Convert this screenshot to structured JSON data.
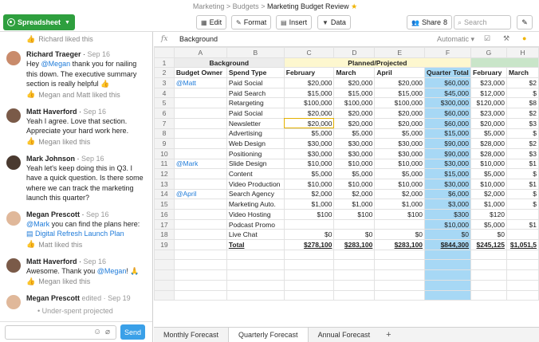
{
  "breadcrumb": {
    "parts": [
      "Marketing",
      ">",
      "Budgets",
      ">"
    ],
    "current": "Marketing Budget Review",
    "star": "★"
  },
  "app_button": "Spreadsheet",
  "toolbar": {
    "edit": "Edit",
    "format": "Format",
    "insert": "Insert",
    "data": "Data",
    "share": "Share",
    "share_count": "8",
    "search_placeholder": "Search"
  },
  "formula_bar": {
    "fx": "fx",
    "value": "Background",
    "format": "Automatic"
  },
  "chat": {
    "top_like": "Richard liked this",
    "messages": [
      {
        "name": "Richard Traeger",
        "time": "Sep 16",
        "pre": "Hey ",
        "mention": "@Megan",
        "post": " thank you for nailing this down. The executive summary section is really helpful 👍",
        "likes": "Megan and Matt liked this"
      },
      {
        "name": "Matt Haverford",
        "time": "Sep 16",
        "pre": "Yeah I agree. Love that section. Appreciate your hard work here.",
        "mention": "",
        "post": "",
        "likes": "Megan liked this"
      },
      {
        "name": "Mark Johnson",
        "time": "Sep 16",
        "pre": "Yeah let's keep doing this in Q3. I have a quick question. Is there some where we can track the marketing launch this quarter?",
        "mention": "",
        "post": "",
        "likes": ""
      },
      {
        "name": "Megan Prescott",
        "time": "Sep 16",
        "pre": "",
        "mention": "@Mark",
        "post": " you can find the plans here:",
        "link": "Digital Refresh Launch Plan",
        "likes": "Matt liked this"
      },
      {
        "name": "Matt Haverford",
        "time": "Sep 16",
        "pre": "Awesome. Thank you ",
        "mention": "@Megan",
        "post": "! 🙏",
        "likes": "Megan liked this"
      },
      {
        "name": "Megan Prescott",
        "time": "edited · Sep 19",
        "pre": "",
        "mention": "",
        "post": "",
        "bullet": "Under-spent projected"
      }
    ],
    "send": "Send"
  },
  "sheet": {
    "columns": [
      "A",
      "B",
      "C",
      "D",
      "E",
      "F",
      "G",
      "H"
    ],
    "row1": {
      "background": "Background",
      "planned": "Planned/Projected"
    },
    "row2": [
      "Budget Owner",
      "Spend Type",
      "February",
      "March",
      "April",
      "Quarter Total",
      "February",
      "March"
    ],
    "rows": [
      [
        "@Matt",
        "Paid Social",
        "$20,000",
        "$20,000",
        "$20,000",
        "$60,000",
        "$23,000",
        "$2"
      ],
      [
        "",
        "Paid Search",
        "$15,000",
        "$15,000",
        "$15,000",
        "$45,000",
        "$12,000",
        "$"
      ],
      [
        "",
        "Retargeting",
        "$100,000",
        "$100,000",
        "$100,000",
        "$300,000",
        "$120,000",
        "$8"
      ],
      [
        "",
        "Paid Social",
        "$20,000",
        "$20,000",
        "$20,000",
        "$60,000",
        "$23,000",
        "$2"
      ],
      [
        "",
        "Newsletter",
        "$20,000",
        "$20,000",
        "$20,000",
        "$60,000",
        "$20,000",
        "$3"
      ],
      [
        "",
        "Advertising",
        "$5,000",
        "$5,000",
        "$5,000",
        "$15,000",
        "$5,000",
        "$"
      ],
      [
        "",
        "Web Design",
        "$30,000",
        "$30,000",
        "$30,000",
        "$90,000",
        "$28,000",
        "$2"
      ],
      [
        "",
        "Positioning",
        "$30,000",
        "$30,000",
        "$30,000",
        "$90,000",
        "$28,000",
        "$3"
      ],
      [
        "@Mark",
        "Slide Design",
        "$10,000",
        "$10,000",
        "$10,000",
        "$30,000",
        "$10,000",
        "$1"
      ],
      [
        "",
        "Content",
        "$5,000",
        "$5,000",
        "$5,000",
        "$15,000",
        "$5,000",
        "$"
      ],
      [
        "",
        "Video Production",
        "$10,000",
        "$10,000",
        "$10,000",
        "$30,000",
        "$10,000",
        "$1"
      ],
      [
        "@April",
        "Search Agency",
        "$2,000",
        "$2,000",
        "$2,000",
        "$6,000",
        "$2,000",
        "$"
      ],
      [
        "",
        "Marketing Auto.",
        "$1,000",
        "$1,000",
        "$1,000",
        "$3,000",
        "$1,000",
        "$"
      ],
      [
        "",
        "Video Hosting",
        "$100",
        "$100",
        "$100",
        "$300",
        "$120",
        ""
      ],
      [
        "",
        "Podcast Promo",
        "",
        "",
        "",
        "$10,000",
        "$5,000",
        "$1"
      ],
      [
        "",
        "Live Chat",
        "$0",
        "$0",
        "$0",
        "$0",
        "$0",
        ""
      ]
    ],
    "total": [
      "",
      "Total",
      "$278,100",
      "$283,100",
      "$283,100",
      "$844,300",
      "$245,125",
      "$1,051,5"
    ],
    "tabs": [
      "Monthly Forecast",
      "Quarterly Forecast",
      "Annual Forecast"
    ],
    "active_tab": 1
  },
  "colors": {
    "brand_green": "#2e9f3e",
    "quarter_total": "#a7d8f5",
    "planned_header": "#fdf7cf",
    "mention": "#1f7bd9",
    "send": "#3aa0e8"
  }
}
